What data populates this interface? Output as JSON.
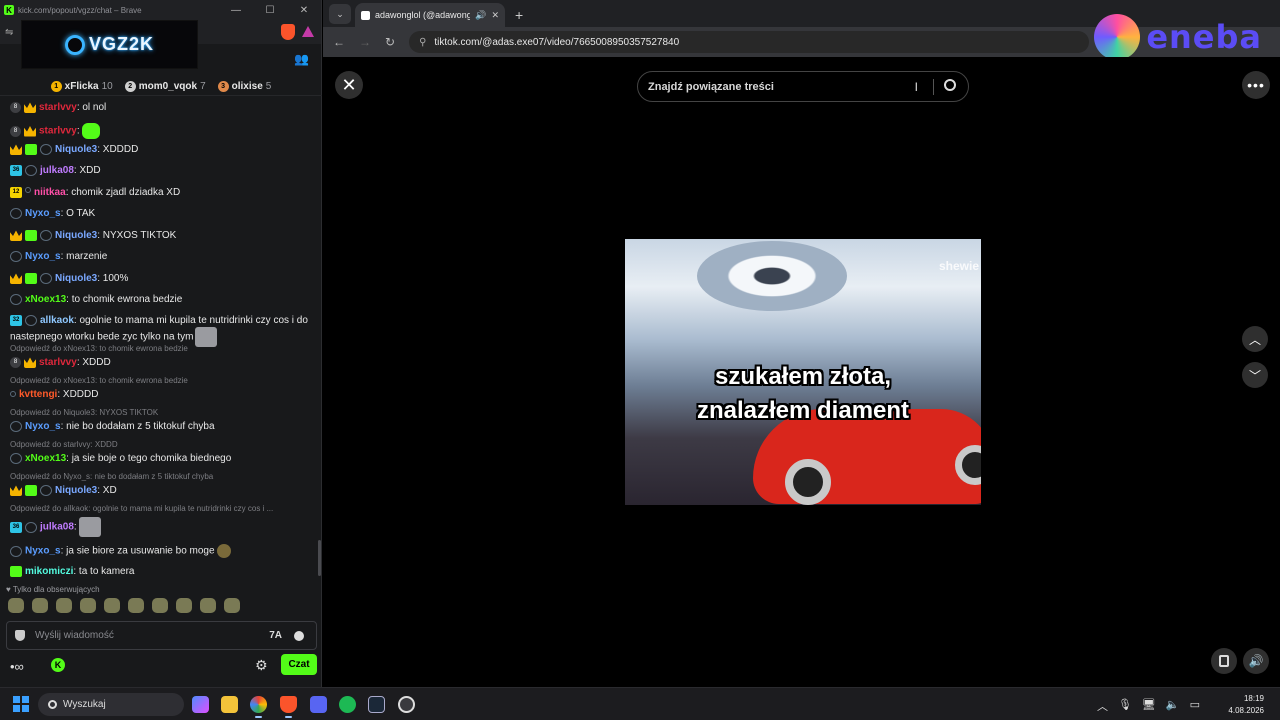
{
  "chat_window": {
    "titlebar": "kick.com/popout/vgzz/chat – Brave",
    "banner_text": "VGZ2K",
    "leaderboard": [
      {
        "rank": "1",
        "name": "xFlicka",
        "count": "10",
        "color": "#f5b400"
      },
      {
        "rank": "2",
        "name": "mom0_vqok",
        "count": "7",
        "color": "#cfcfcf"
      },
      {
        "rank": "3",
        "name": "olixise",
        "count": "5",
        "color": "#e0894a"
      }
    ],
    "messages": [
      {
        "user": "starlvvy",
        "color": "#e0283c",
        "text": ": ol nol",
        "badges": [
          "circle",
          "crown"
        ]
      },
      {
        "user": "starlvvy",
        "color": "#e0283c",
        "text": ":",
        "badges": [
          "circle",
          "crown"
        ],
        "emote": "green"
      },
      {
        "user": "Niquole3",
        "color": "#7aa8ff",
        "text": ": XDDDD",
        "badges": [
          "crown",
          "gift",
          "sub"
        ]
      },
      {
        "user": "julka08",
        "color": "#c07cff",
        "text": ": XDD",
        "badges": [
          "num",
          "sub"
        ],
        "num": "36"
      },
      {
        "user": "niitkaa",
        "color": "#ff4fa8",
        "text": ": chomik zjadl dziadka XD",
        "badges": [
          "numy",
          "dot"
        ],
        "num": "12"
      },
      {
        "user": "Nyxo_s",
        "color": "#5b9dff",
        "text": ": O TAK",
        "badges": [
          "sub"
        ]
      },
      {
        "user": "Niquole3",
        "color": "#7aa8ff",
        "text": ": NYXOS TIKTOK",
        "badges": [
          "crown",
          "gift",
          "sub"
        ]
      },
      {
        "user": "Nyxo_s",
        "color": "#5b9dff",
        "text": ": marzenie",
        "badges": [
          "sub"
        ]
      },
      {
        "user": "Niquole3",
        "color": "#7aa8ff",
        "text": ": 100%",
        "badges": [
          "crown",
          "gift",
          "sub"
        ]
      },
      {
        "user": "xNoex13",
        "color": "#53fc18",
        "text": ": to chomik ewrona bedzie",
        "badges": [
          "sub"
        ]
      },
      {
        "user": "allkaok",
        "color": "#8fc8ff",
        "text": ": ogolnie to mama mi kupila te nutridrinki czy cos i do",
        "badges": [
          "num",
          "sub"
        ],
        "num": "32"
      },
      {
        "user": "",
        "color": "#e8e8e8",
        "text": "nastepnego wtorku bede zyc tylko na tym",
        "badges": [],
        "emote": "cat"
      },
      {
        "user": "starlvvy",
        "color": "#e0283c",
        "text": ": XDDD",
        "badges": [
          "circle",
          "crown"
        ],
        "reply": "Odpowiedź do xNoex13: to chomik ewrona bedzie"
      },
      {
        "user": "kvttengi",
        "color": "#ff5a2a",
        "text": ": XDDDD",
        "badges": [
          "dot"
        ],
        "reply": "Odpowiedź do xNoex13: to chomik ewrona bedzie"
      },
      {
        "user": "Nyxo_s",
        "color": "#5b9dff",
        "text": ": nie bo dodałam z 5 tiktokuf chyba",
        "badges": [
          "sub"
        ],
        "reply": "Odpowiedź do Niquole3: NYXOS TIKTOK"
      },
      {
        "user": "xNoex13",
        "color": "#53fc18",
        "text": ": ja sie boje o tego chomika biednego",
        "badges": [
          "sub"
        ],
        "reply": "Odpowiedź do starlvvy: XDDD"
      },
      {
        "user": "Niquole3",
        "color": "#7aa8ff",
        "text": ": XD",
        "badges": [
          "crown",
          "gift",
          "sub"
        ],
        "reply": "Odpowiedź do Nyxo_s: nie bo dodałam z 5 tiktokuf chyba"
      },
      {
        "user": "julka08",
        "color": "#c07cff",
        "text": ":",
        "badges": [
          "num",
          "sub"
        ],
        "num": "36",
        "emote": "cat",
        "reply": "Odpowiedź do allkaok: ogolnie to mama mi kupila te nutridrinki czy cos i ..."
      },
      {
        "user": "Nyxo_s",
        "color": "#5b9dff",
        "text": ": ja sie biore za usuwanie bo moge",
        "badges": [
          "sub"
        ],
        "emote": "grn"
      },
      {
        "user": "mikomiczi",
        "color": "#53fce0",
        "text": ": ta to kamera",
        "badges": [
          "gift"
        ]
      }
    ],
    "followers_only": "Tylko dla obserwujących",
    "input_placeholder": "Wyślij wiadomość",
    "chat_button": "Czat"
  },
  "browser": {
    "tab_title": "adawonglol (@adawonglol)",
    "url": "tiktok.com/@adas.exe07/video/7665008950357527840",
    "ad_brand": "eneba",
    "search_placeholder": "Znajdź powiązane treści",
    "video_watermark": "shewie",
    "caption_line1": "szukałem złota,",
    "caption_line2": "znalazłem diament"
  },
  "taskbar": {
    "search_label": "Wyszukaj",
    "time": "18:19",
    "date": "4.08.2026"
  }
}
